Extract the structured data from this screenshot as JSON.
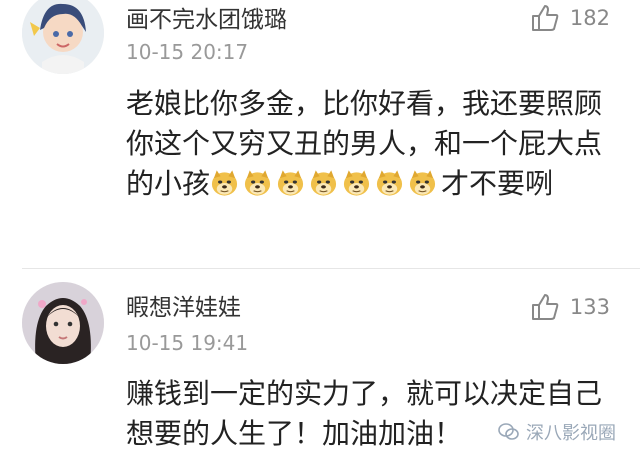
{
  "comments": [
    {
      "user": "画不完水团饿璐",
      "time": "10-15 20:17",
      "likes": "182",
      "text_before": "老娘比你多金，比你好看，我还要照顾你这个又穷又丑的男人，和一个屁大点的小孩",
      "emoji_count": 7,
      "text_after": "才不要咧"
    },
    {
      "user": "暇想洋娃娃",
      "time": "10-15 19:41",
      "likes": "133",
      "text": "赚钱到一定的实力了，就可以决定自己想要的人生了！加油加油！"
    }
  ],
  "watermark": "深八影视圈",
  "icons": [
    "thumbs-up-icon",
    "doge-emoji-icon",
    "wechat-icon"
  ]
}
